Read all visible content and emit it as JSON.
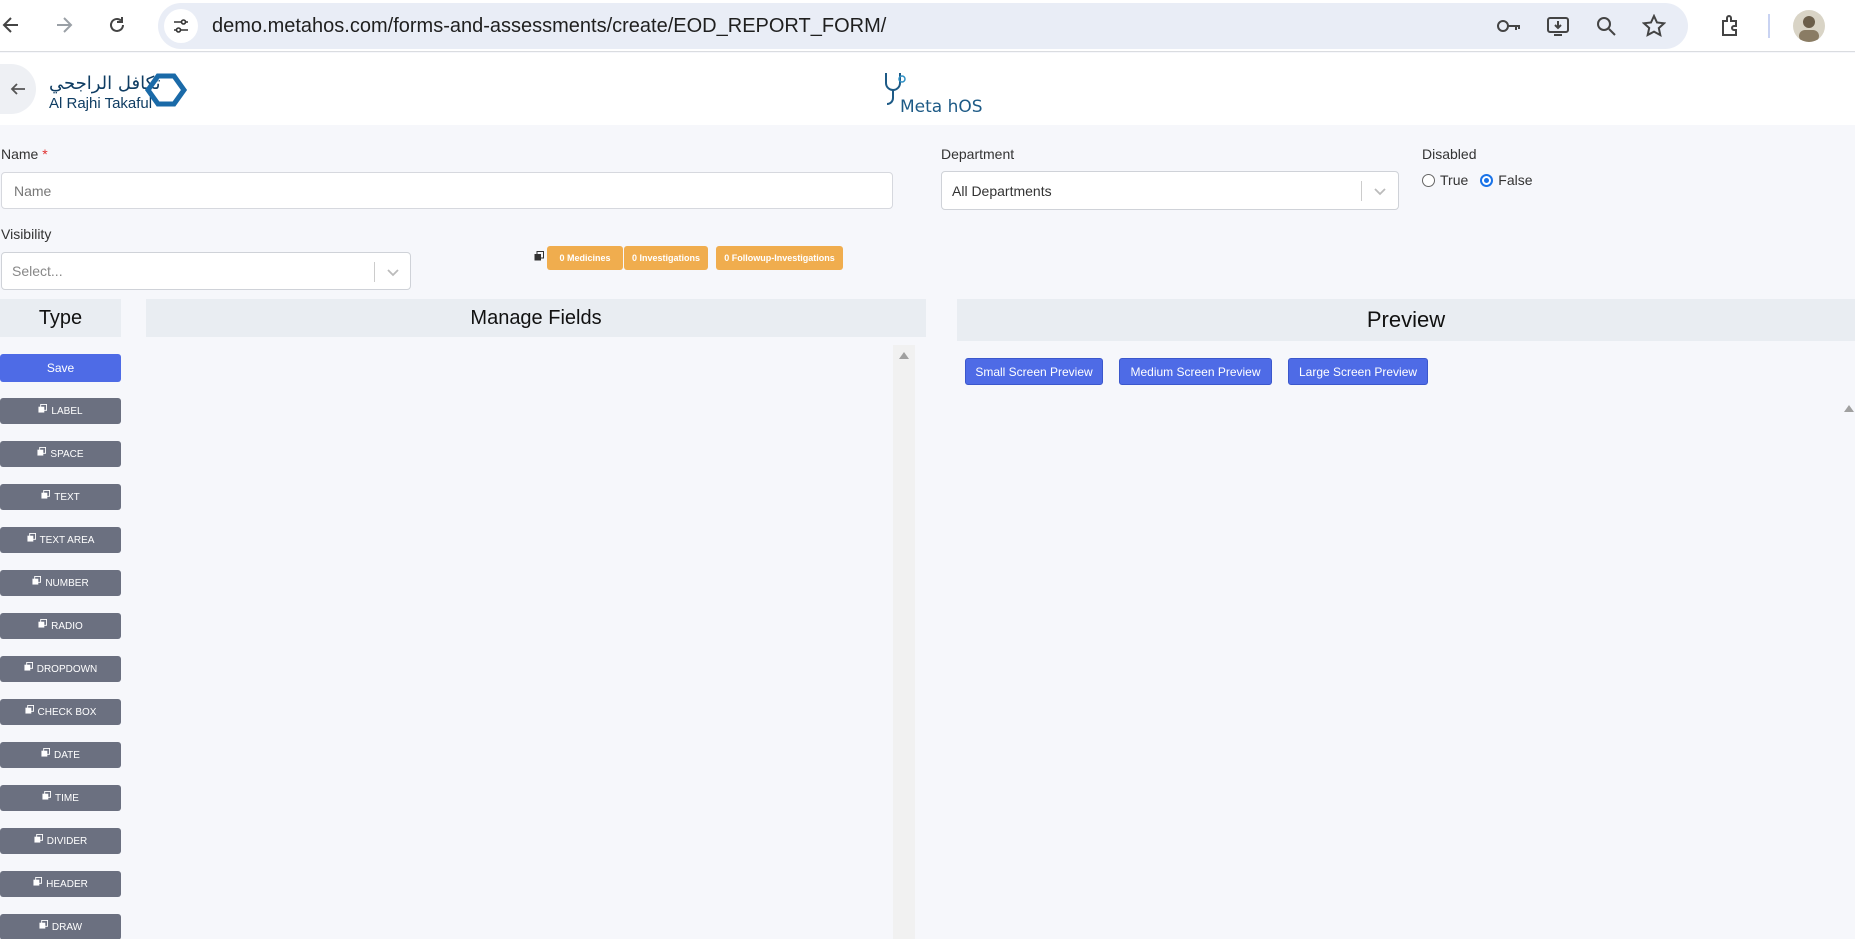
{
  "browser": {
    "url": "demo.metahos.com/forms-and-assessments/create/EOD_REPORT_FORM/"
  },
  "header": {
    "brand_arabic": "تكافل الراجحي",
    "brand_english": "Al Rajhi Takaful",
    "app_logo_text": "Meta hOS"
  },
  "form": {
    "name_label": "Name",
    "name_required_mark": "*",
    "name_placeholder": "Name",
    "department_label": "Department",
    "department_value": "All Departments",
    "disabled_label": "Disabled",
    "disabled_options": [
      "True",
      "False"
    ],
    "disabled_selected": "False",
    "visibility_label": "Visibility",
    "visibility_placeholder": "Select..."
  },
  "badges": {
    "medicines": "0 Medicines",
    "investigations": "0 Investigations",
    "followup": "0 Followup-Investigations"
  },
  "type_panel": {
    "title": "Type",
    "save_label": "Save",
    "items": [
      "LABEL",
      "SPACE",
      "TEXT",
      "TEXT AREA",
      "NUMBER",
      "RADIO",
      "DROPDOWN",
      "CHECK BOX",
      "DATE",
      "TIME",
      "DIVIDER",
      "HEADER",
      "DRAW"
    ]
  },
  "manage_fields": {
    "title": "Manage Fields"
  },
  "preview": {
    "title": "Preview",
    "small_label": "Small Screen Preview",
    "medium_label": "Medium Screen Preview",
    "large_label": "Large Screen Preview"
  },
  "colors": {
    "primary": "#4e6be6",
    "badge": "#f0ad4e",
    "type_button": "#6b7080"
  }
}
